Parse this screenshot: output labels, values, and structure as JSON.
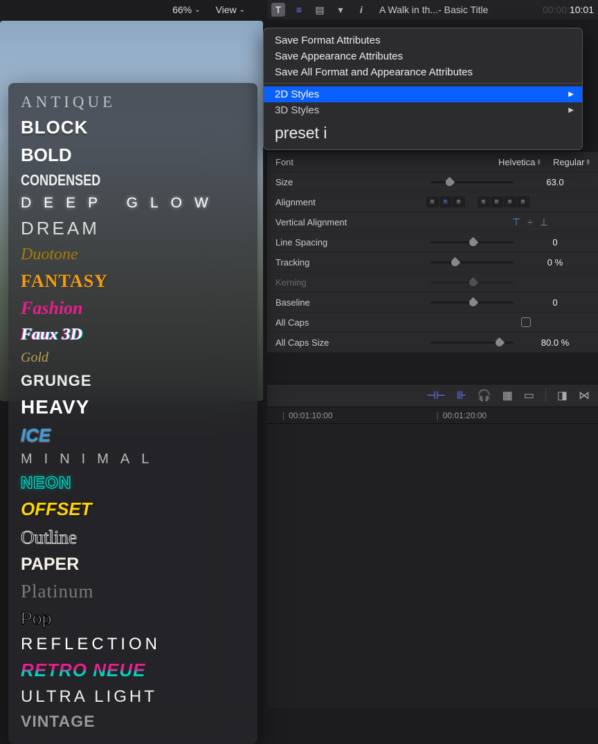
{
  "toolbar": {
    "zoom": "66%",
    "view_label": "View"
  },
  "header": {
    "title": "A Walk in th...- Basic Title",
    "timecode_dim": "00:00:",
    "timecode_bright": "10:01"
  },
  "context_menu": {
    "save_format": "Save Format Attributes",
    "save_appearance": "Save Appearance Attributes",
    "save_all": "Save All Format and Appearance Attributes",
    "styles_2d": "2D Styles",
    "styles_3d": "3D Styles",
    "search": "preset i"
  },
  "style_presets": [
    {
      "id": "antique",
      "label": "ANTIQUE"
    },
    {
      "id": "block",
      "label": "BLOCK"
    },
    {
      "id": "bold",
      "label": "BOLD"
    },
    {
      "id": "condensed",
      "label": "CONDENSED"
    },
    {
      "id": "deepglow",
      "label": "DEEP GLOW"
    },
    {
      "id": "dream",
      "label": "DREAM"
    },
    {
      "id": "duotone",
      "label": "Duotone"
    },
    {
      "id": "fantasy",
      "label": "FANTASY"
    },
    {
      "id": "fashion",
      "label": "Fashion"
    },
    {
      "id": "faux3d",
      "label": "Faux 3D"
    },
    {
      "id": "gold",
      "label": "Gold"
    },
    {
      "id": "grunge",
      "label": "GRUNGE"
    },
    {
      "id": "heavy",
      "label": "HEAVY"
    },
    {
      "id": "ice",
      "label": "ICE"
    },
    {
      "id": "minimal",
      "label": "MINIMAL"
    },
    {
      "id": "neon",
      "label": "NEON"
    },
    {
      "id": "offset",
      "label": "OFFSET"
    },
    {
      "id": "outline",
      "label": "Outline"
    },
    {
      "id": "paper",
      "label": "PAPER"
    },
    {
      "id": "platinum",
      "label": "Platinum"
    },
    {
      "id": "pop",
      "label": "Pop"
    },
    {
      "id": "reflection",
      "label": "REFLECTION"
    },
    {
      "id": "retroneue",
      "label": "RETRO NEUE"
    },
    {
      "id": "ultralight",
      "label": "ULTRA LIGHT"
    },
    {
      "id": "vintage",
      "label": "VINTAGE"
    }
  ],
  "inspector": {
    "font_label": "Font",
    "font_family": "Helvetica",
    "font_style": "Regular",
    "size_label": "Size",
    "size_value": "63.0",
    "alignment_label": "Alignment",
    "valign_label": "Vertical Alignment",
    "line_spacing_label": "Line Spacing",
    "line_spacing_value": "0",
    "tracking_label": "Tracking",
    "tracking_value": "0 %",
    "kerning_label": "Kerning",
    "baseline_label": "Baseline",
    "baseline_value": "0",
    "allcaps_label": "All Caps",
    "allcaps_size_label": "All Caps Size",
    "allcaps_size_value": "80.0 %"
  },
  "timeline": {
    "tick1": "00:01:10:00",
    "tick2": "00:01:20:00"
  }
}
